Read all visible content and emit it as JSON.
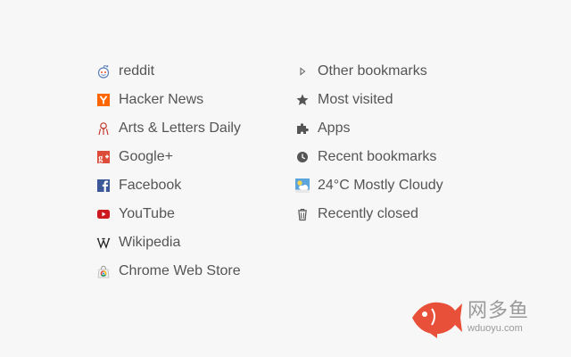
{
  "bookmarks_bar": [
    {
      "label": "reddit",
      "icon": "reddit-alien-icon"
    },
    {
      "label": "Hacker News",
      "icon": "hacker-news-icon"
    },
    {
      "label": "Arts & Letters Daily",
      "icon": "arts-letters-daily-icon"
    },
    {
      "label": "Google+",
      "icon": "google-plus-icon"
    },
    {
      "label": "Facebook",
      "icon": "facebook-icon"
    },
    {
      "label": "YouTube",
      "icon": "youtube-icon"
    },
    {
      "label": "Wikipedia",
      "icon": "wikipedia-icon"
    },
    {
      "label": "Chrome Web Store",
      "icon": "chrome-web-store-icon"
    }
  ],
  "menu": [
    {
      "label": "Other bookmarks",
      "icon": "triangle-right-icon"
    },
    {
      "label": "Most visited",
      "icon": "star-icon"
    },
    {
      "label": "Apps",
      "icon": "puzzle-piece-icon"
    },
    {
      "label": "Recent bookmarks",
      "icon": "clock-icon"
    },
    {
      "label": "24°C Mostly Cloudy",
      "icon": "weather-partly-cloudy-icon"
    },
    {
      "label": "Recently closed",
      "icon": "trash-can-icon"
    }
  ],
  "watermark": {
    "brand": "网多鱼",
    "url": "wduoyu.com"
  },
  "colors": {
    "text": "#555555",
    "hacker_news": "#ff6600",
    "google_plus": "#dd4b39",
    "facebook": "#3b5998",
    "youtube": "#cc181e",
    "fish": "#e8503a"
  }
}
